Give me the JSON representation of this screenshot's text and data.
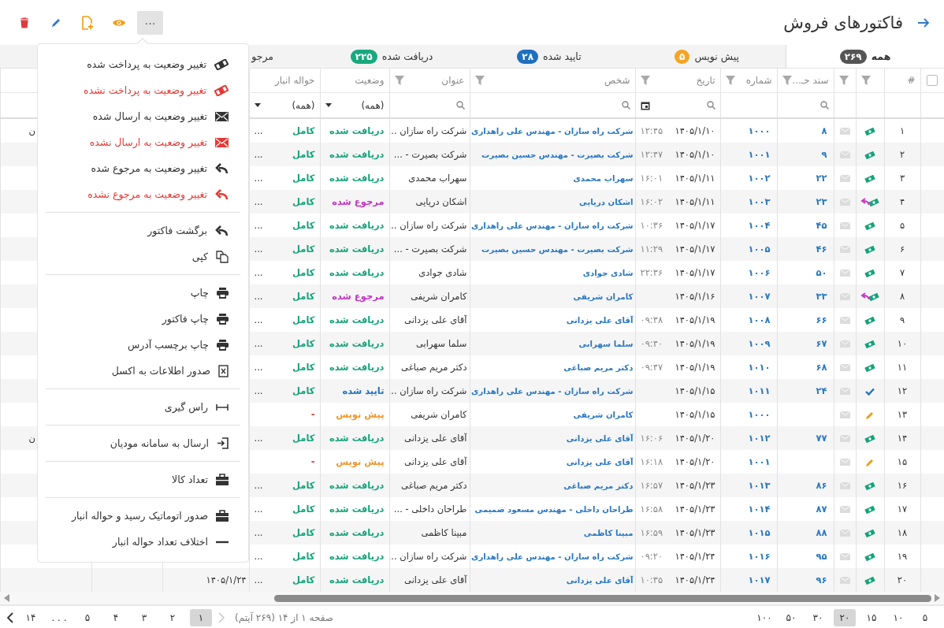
{
  "header": {
    "title": "فاکتورهای فروش"
  },
  "toolbar": [
    {
      "kind": "delete"
    },
    {
      "kind": "edit"
    },
    {
      "kind": "add"
    },
    {
      "kind": "view"
    },
    {
      "kind": "more",
      "label": "···",
      "pressed": true
    }
  ],
  "tabs": [
    {
      "label": "همه",
      "count": "۲۶۹",
      "color": "#555555",
      "selected": true
    },
    {
      "label": "پیش نویس",
      "count": "۵",
      "color": "#f5a524",
      "selected": false
    },
    {
      "label": "تایید شده",
      "count": "۲۸",
      "color": "#1f6fbf",
      "selected": false
    },
    {
      "label": "دریافت شده",
      "count": "۲۲۵",
      "color": "#19a97e",
      "selected": false
    },
    {
      "label": "مرجو",
      "selected": false
    }
  ],
  "table": {
    "select_all": {
      "checked": false
    },
    "columns": [
      {
        "label": "#"
      },
      {
        "filter": true
      },
      {
        "filter": true
      },
      {
        "label": "سند حـ...",
        "filter": true,
        "filter_cell": {
          "kind": "search"
        }
      },
      {
        "label": "شماره",
        "filter": true
      },
      {
        "label": "تاریخ",
        "filter": true,
        "filter_cell": {
          "kind": "date"
        }
      },
      {
        "label": "شخص",
        "filter": true,
        "filter_cell": {
          "kind": "search"
        }
      },
      {
        "label": "عنوان",
        "filter": true,
        "filter_cell": {
          "kind": "search"
        }
      },
      {
        "label": "وضعیت",
        "filter_cell": {
          "kind": "select",
          "value": "(همه)"
        }
      },
      {
        "label": "حواله انبار",
        "filter_cell": {
          "kind": "select",
          "value": "(همه)"
        }
      }
    ],
    "rows": [
      {
        "index": "۱",
        "kind": "paid",
        "doc": "۸",
        "number": "۱۰۰۰",
        "date": "۱۴۰۵/۱/۱۰",
        "time": "۱۲:۴۵",
        "person": "شرکت راه سازان - مهندس علی راهداری",
        "title": "شرکت راه سازان ...",
        "status": {
          "text": "دریافت شده",
          "kind": "received"
        },
        "warehouse": {
          "text": "کامل",
          "kind": "complete"
        },
        "more": "...",
        "column_14": "ن"
      },
      {
        "index": "۲",
        "kind": "paid",
        "doc": "۹",
        "number": "۱۰۰۱",
        "date": "۱۴۰۵/۱/۱۰",
        "time": "۱۲:۴۷",
        "person": "شرکت بصیرت - مهندس حسین بصیرت",
        "title": "شرکت بصیرت - ...",
        "status": {
          "text": "دریافت شده",
          "kind": "received"
        },
        "warehouse": {
          "text": "کامل",
          "kind": "complete"
        },
        "more": "..."
      },
      {
        "index": "۳",
        "kind": "paid",
        "doc": "۲۲",
        "number": "۱۰۰۲",
        "date": "۱۴۰۵/۱/۱۱",
        "time": "۱۶:۰۱",
        "person": "سهراب محمدی",
        "title": "سهراب محمدی",
        "status": {
          "text": "دریافت شده",
          "kind": "received"
        },
        "warehouse": {
          "text": "کامل",
          "kind": "complete"
        },
        "more": "..."
      },
      {
        "index": "۴",
        "kind": "paid_returned",
        "doc": "۲۳",
        "number": "۱۰۰۳",
        "date": "۱۴۰۵/۱/۱۱",
        "time": "۱۶:۰۲",
        "person": "اشکان دریایی",
        "title": "اشکان دریایی",
        "status": {
          "text": "مرجوع شده",
          "kind": "returned"
        },
        "warehouse": {
          "text": "کامل",
          "kind": "complete"
        },
        "more": "..."
      },
      {
        "index": "۵",
        "kind": "paid",
        "doc": "۴۵",
        "number": "۱۰۰۴",
        "date": "۱۴۰۵/۱/۱۷",
        "time": "۱۰:۳۶",
        "person": "شرکت راه سازان - مهندس علی راهداری",
        "title": "شرکت راه سازان ...",
        "status": {
          "text": "دریافت شده",
          "kind": "received"
        },
        "warehouse": {
          "text": "کامل",
          "kind": "complete"
        },
        "more": "..."
      },
      {
        "index": "۶",
        "kind": "paid",
        "doc": "۴۶",
        "number": "۱۰۰۵",
        "date": "۱۴۰۵/۱/۱۷",
        "time": "۱۱:۲۹",
        "person": "شرکت بصیرت - مهندس حسین بصیرت",
        "title": "شرکت بصیرت - ...",
        "status": {
          "text": "دریافت شده",
          "kind": "received"
        },
        "warehouse": {
          "text": "کامل",
          "kind": "complete"
        },
        "more": "..."
      },
      {
        "index": "۷",
        "kind": "paid",
        "doc": "۵۰",
        "number": "۱۰۰۶",
        "date": "۱۴۰۵/۱/۱۷",
        "time": "۲۲:۳۶",
        "person": "شادی جوادی",
        "title": "شادی جوادی",
        "status": {
          "text": "دریافت شده",
          "kind": "received"
        },
        "warehouse": {
          "text": "کامل",
          "kind": "complete"
        },
        "more": "..."
      },
      {
        "index": "۸",
        "kind": "paid_returned",
        "doc": "۳۳",
        "number": "۱۰۰۷",
        "date": "۱۴۰۵/۱/۱۶",
        "person": "کامران شریفی",
        "title": "کامران شریفی",
        "status": {
          "text": "مرجوع شده",
          "kind": "returned"
        },
        "warehouse": {
          "text": "کامل",
          "kind": "complete"
        },
        "more": "..."
      },
      {
        "index": "۹",
        "kind": "paid",
        "doc": "۶۶",
        "number": "۱۰۰۸",
        "date": "۱۴۰۵/۱/۱۹",
        "time": "۰۹:۳۸",
        "person": "آقای علی یزدانی",
        "title": "آقای علی یزدانی",
        "status": {
          "text": "دریافت شده",
          "kind": "received"
        },
        "warehouse": {
          "text": "کامل",
          "kind": "complete"
        },
        "more": "..."
      },
      {
        "index": "۱۰",
        "kind": "paid",
        "doc": "۶۷",
        "number": "۱۰۰۹",
        "date": "۱۴۰۵/۱/۱۹",
        "time": "۰۹:۴۰",
        "person": "سلما سهرابی",
        "title": "سلما سهرابی",
        "status": {
          "text": "دریافت شده",
          "kind": "received"
        },
        "warehouse": {
          "text": "کامل",
          "kind": "complete"
        },
        "more": "..."
      },
      {
        "index": "۱۱",
        "kind": "paid",
        "doc": "۶۸",
        "number": "۱۰۱۰",
        "date": "۱۴۰۵/۱/۱۹",
        "time": "۰۹:۴۷",
        "person": "دکتر مریم صباغی",
        "title": "دکتر مریم صباغی",
        "status": {
          "text": "دریافت شده",
          "kind": "received"
        },
        "warehouse": {
          "text": "کامل",
          "kind": "complete"
        },
        "more": "..."
      },
      {
        "index": "۱۲",
        "kind": "confirmed",
        "doc": "۲۴",
        "number": "۱۰۱۱",
        "date": "۱۴۰۵/۱/۱۵",
        "person": "شرکت راه سازان - مهندس علی راهداری",
        "title": "شرکت راه سازان ...",
        "status": {
          "text": "تایید شده",
          "kind": "confirmed"
        },
        "warehouse": {
          "text": "کامل",
          "kind": "complete"
        },
        "more": "..."
      },
      {
        "index": "۱۳",
        "kind": "draft",
        "number": "۱۰۰۰",
        "date": "۱۴۰۵/۱/۱۵",
        "person": "کامران شریفی",
        "title": "کامران شریفی",
        "status": {
          "text": "پیش نویس",
          "kind": "draft"
        },
        "warehouse": {
          "text": "-",
          "kind": "none"
        }
      },
      {
        "index": "۱۴",
        "kind": "paid",
        "doc": "۷۷",
        "number": "۱۰۱۲",
        "date": "۱۴۰۵/۱/۲۰",
        "time": "۱۶:۰۶",
        "person": "آقای علی یزدانی",
        "title": "آقای علی یزدانی",
        "status": {
          "text": "دریافت شده",
          "kind": "received"
        },
        "warehouse": {
          "text": "کامل",
          "kind": "complete"
        },
        "more": "...",
        "column_14": "ن"
      },
      {
        "index": "۱۵",
        "kind": "draft",
        "number": "۱۰۰۱",
        "date": "۱۴۰۵/۱/۲۰",
        "time": "۱۶:۱۸",
        "person": "آقای علی یزدانی",
        "title": "آقای علی یزدانی",
        "status": {
          "text": "پیش نویس",
          "kind": "draft"
        },
        "warehouse": {
          "text": "-",
          "kind": "none"
        }
      },
      {
        "index": "۱۶",
        "kind": "paid",
        "doc": "۸۶",
        "number": "۱۰۱۳",
        "date": "۱۴۰۵/۱/۲۳",
        "time": "۱۶:۵۷",
        "person": "دکتر مریم صباغی",
        "title": "دکتر مریم صباغی",
        "status": {
          "text": "دریافت شده",
          "kind": "received"
        },
        "warehouse": {
          "text": "کامل",
          "kind": "complete"
        },
        "more": "..."
      },
      {
        "index": "۱۷",
        "kind": "paid",
        "doc": "۸۷",
        "number": "۱۰۱۴",
        "date": "۱۴۰۵/۱/۲۳",
        "time": "۱۶:۵۸",
        "person": "طراحان داخلی - مهندس مسعود صمیمی",
        "title": "طراحان داخلی - ...",
        "status": {
          "text": "دریافت شده",
          "kind": "received"
        },
        "warehouse": {
          "text": "کامل",
          "kind": "complete"
        },
        "more": "..."
      },
      {
        "index": "۱۸",
        "kind": "paid",
        "doc": "۸۸",
        "number": "۱۰۱۵",
        "date": "۱۴۰۵/۱/۲۳",
        "time": "۱۶:۵۹",
        "person": "مبینا کاظمی",
        "title": "مبینا کاظمی",
        "status": {
          "text": "دریافت شده",
          "kind": "received"
        },
        "warehouse": {
          "text": "کامل",
          "kind": "complete"
        },
        "more": "..."
      },
      {
        "index": "۱۹",
        "kind": "paid",
        "doc": "۹۵",
        "number": "۱۰۱۶",
        "date": "۱۴۰۵/۱/۲۴",
        "time": "۰۹:۲۰",
        "person": "شرکت راه سازان - مهندس علی راهداری",
        "title": "شرکت راه سازان ...",
        "status": {
          "text": "دریافت شده",
          "kind": "received"
        },
        "warehouse": {
          "text": "کامل",
          "kind": "complete"
        },
        "more": "..."
      },
      {
        "index": "۲۰",
        "kind": "paid",
        "doc": "۹۶",
        "number": "۱۰۱۷",
        "date": "۱۴۰۵/۱/۲۴",
        "time": "۱۰:۳۵",
        "person": "آقای علی یزدانی",
        "title": "آقای علی یزدانی",
        "status": {
          "text": "دریافت شده",
          "kind": "received"
        },
        "warehouse": {
          "text": "کامل",
          "kind": "complete"
        },
        "more": "...",
        "column_12": "۱۴۰۵/۱/۲۴"
      }
    ]
  },
  "menu": {
    "sections": [
      {
        "items": [
          {
            "label": "تغییر وضعیت به پرداخت شده",
            "kind": "banknote",
            "danger": false
          },
          {
            "label": "تغییر وضعیت به پرداخت نشده",
            "kind": "banknote",
            "danger": true
          },
          {
            "label": "تغییر وضعیت به ارسال شده",
            "kind": "envelope",
            "danger": false
          },
          {
            "label": "تغییر وضعیت به ارسال نشده",
            "kind": "envelope",
            "danger": true
          },
          {
            "label": "تغییر وضعیت به مرجوع شده",
            "kind": "reply",
            "danger": false
          },
          {
            "label": "تغییر وضعیت به مرجوع نشده",
            "kind": "reply",
            "danger": true
          }
        ]
      },
      {
        "items": [
          {
            "label": "برگشت فاکتور",
            "kind": "reply",
            "danger": false
          },
          {
            "label": "کپی",
            "kind": "copy",
            "danger": false
          }
        ]
      },
      {
        "items": [
          {
            "label": "چاپ",
            "kind": "print",
            "danger": false
          },
          {
            "label": "چاپ فاکتور",
            "kind": "print",
            "danger": false
          },
          {
            "label": "چاپ برچسب آدرس",
            "kind": "print",
            "danger": false
          },
          {
            "label": "صدور اطلاعات به اکسل",
            "kind": "excel",
            "danger": false
          }
        ]
      },
      {
        "items": [
          {
            "label": "راس گیری",
            "kind": "measure",
            "danger": false
          }
        ]
      },
      {
        "items": [
          {
            "label": "ارسال به سامانه مودیان",
            "kind": "enter",
            "danger": false
          }
        ]
      },
      {
        "items": [
          {
            "label": "تعداد کالا",
            "kind": "toolbox",
            "danger": false
          }
        ]
      },
      {
        "items": [
          {
            "label": "صدور اتوماتیک رسید و حواله انبار",
            "kind": "toolbox",
            "danger": false
          },
          {
            "label": "اختلاف تعداد حواله انبار",
            "kind": "minus",
            "danger": false
          }
        ]
      }
    ]
  },
  "footer": {
    "page_sizes": [
      {
        "label": "۵",
        "selected": false
      },
      {
        "label": "۱۰",
        "selected": false
      },
      {
        "label": "۱۵",
        "selected": false
      },
      {
        "label": "۲۰",
        "selected": true
      },
      {
        "label": "۳۰",
        "selected": false
      },
      {
        "label": "۵۰",
        "selected": false
      },
      {
        "label": "۱۰۰",
        "selected": false
      }
    ],
    "info": "صفحه ۱ از ۱۴ (۲۶۹ آیتم)",
    "prev_disabled": true,
    "next_disabled": false,
    "pages": [
      {
        "label": "۱",
        "selected": true
      },
      {
        "label": "۲",
        "selected": false
      },
      {
        "label": "۳",
        "selected": false
      },
      {
        "label": "۴",
        "selected": false
      },
      {
        "label": "۵",
        "selected": false
      },
      {
        "label": ". . .",
        "selected": false
      },
      {
        "label": "۱۴",
        "selected": false
      }
    ]
  }
}
